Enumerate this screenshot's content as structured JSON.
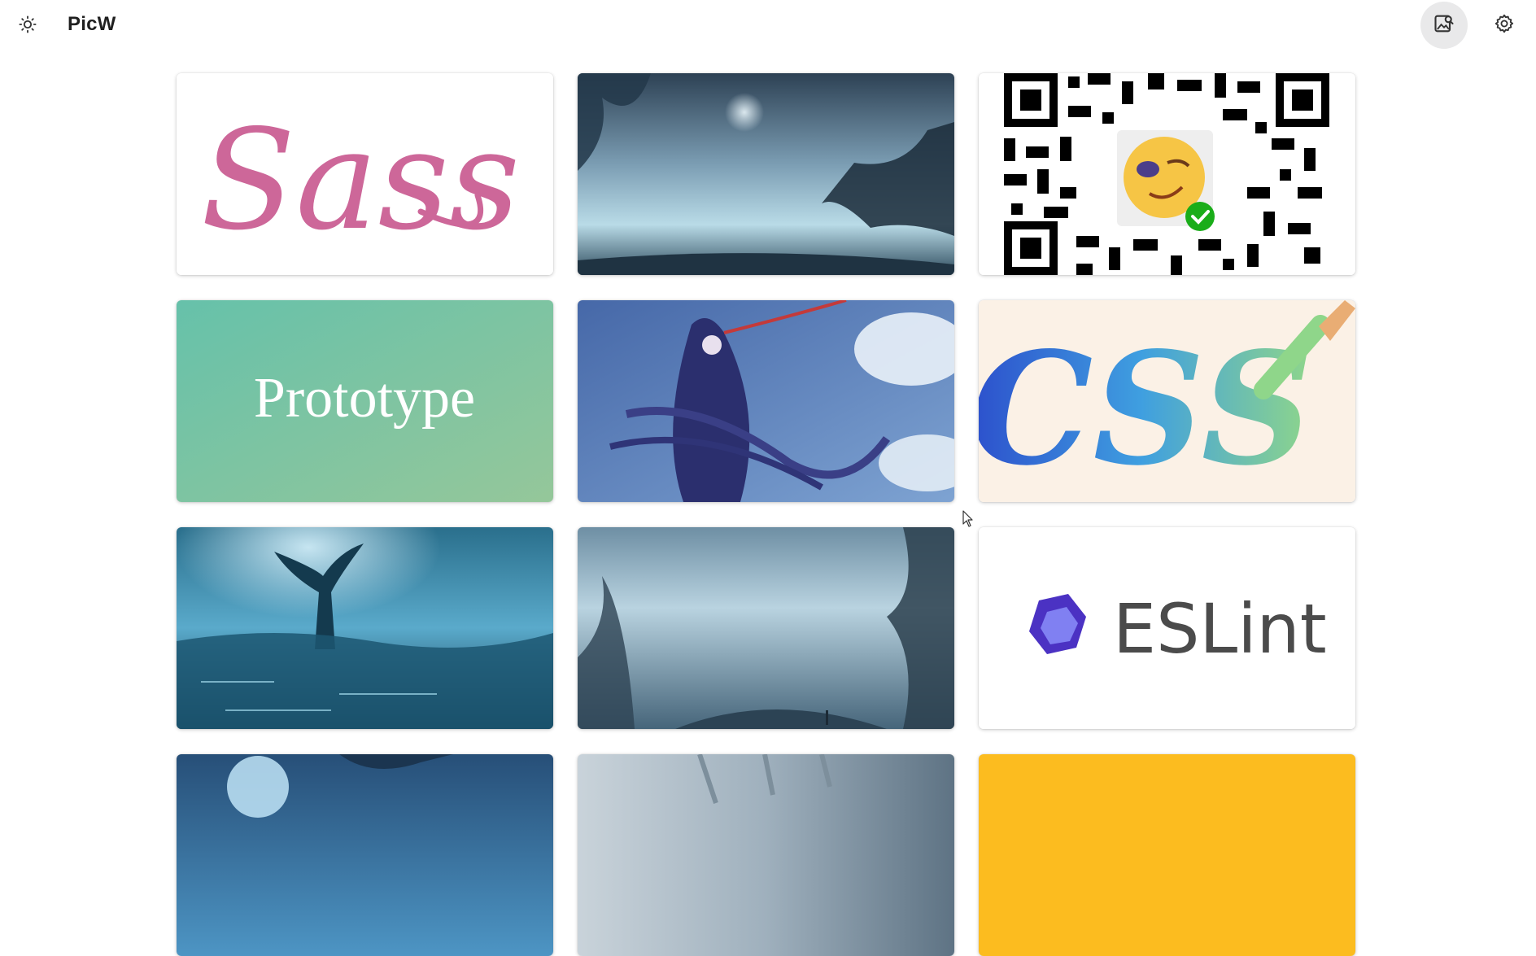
{
  "app": {
    "title": "PicW"
  },
  "header": {
    "theme_icon": "sun-icon",
    "upload_icon": "image-search-icon",
    "settings_icon": "gear-icon"
  },
  "gallery": {
    "items": [
      {
        "kind": "logo",
        "text": "Sass",
        "color": "#cd6799",
        "bg": "#ffffff"
      },
      {
        "kind": "photo",
        "subject": "misty moonlit forest lake",
        "bg": "#6f93a8"
      },
      {
        "kind": "qr",
        "subject": "wechat qr code with emoji",
        "bg": "#ffffff"
      },
      {
        "kind": "logo",
        "text": "Prototype",
        "color": "#ffffff",
        "bg": "#7cc4a6"
      },
      {
        "kind": "illustration",
        "subject": "anime girl with long flowing hair",
        "bg": "#5b85bf"
      },
      {
        "kind": "logo",
        "text": "CSS",
        "color": "#3f6fd6",
        "bg": "#fbf1e6"
      },
      {
        "kind": "photo",
        "subject": "blue glowing tree over water",
        "bg": "#3a7c98"
      },
      {
        "kind": "photo",
        "subject": "foggy blue forest",
        "bg": "#8fb0c3"
      },
      {
        "kind": "logo",
        "text": "ESLint",
        "color": "#4b32c3",
        "bg": "#ffffff"
      },
      {
        "kind": "photo",
        "subject": "moon over blue forest",
        "bg": "#3c78a5"
      },
      {
        "kind": "photo",
        "subject": "pale waterfall painting",
        "bg": "#9fb0bd"
      },
      {
        "kind": "solid",
        "subject": "yellow card",
        "bg": "#fcbc1f"
      }
    ]
  },
  "colors": {
    "accent": "#e9e9ea",
    "text": "#1f1f1f"
  }
}
